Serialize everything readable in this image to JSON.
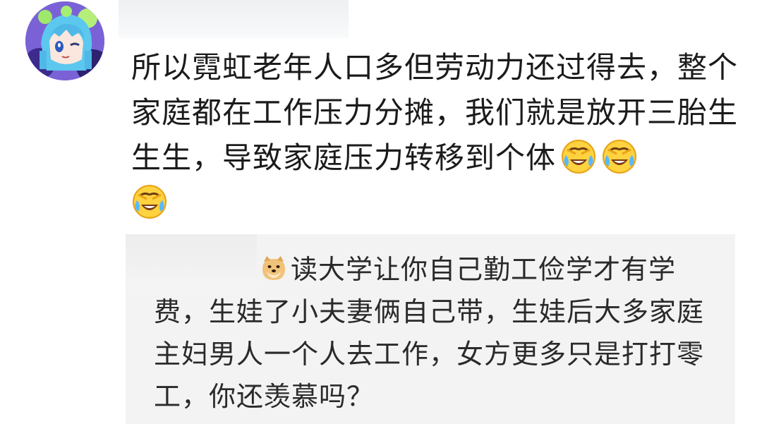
{
  "comment": {
    "avatar_icon": "anime-avatar",
    "text": "所以霓虹老年人口多但劳动力还过得去，整个家庭都在工作压力分摊，我们就是放开三胎生生生，导致家庭压力转移到个体",
    "emojis": [
      "laugh-cry-emoji",
      "laugh-cry-emoji",
      "laugh-cry-emoji"
    ]
  },
  "reply": {
    "emoji": "doge-emoji",
    "text_line1": "读大学让你自己勤工俭学才有学",
    "text_rest": "费，生娃了小夫妻俩自己带，生娃后大多家庭主妇男人一个人去工作，女方更多只是打打零工，你还羡慕吗？"
  },
  "colors": {
    "text": "#1b1b1b",
    "reply_bg": "#f3f3f3",
    "blur": "#eef0f2"
  }
}
